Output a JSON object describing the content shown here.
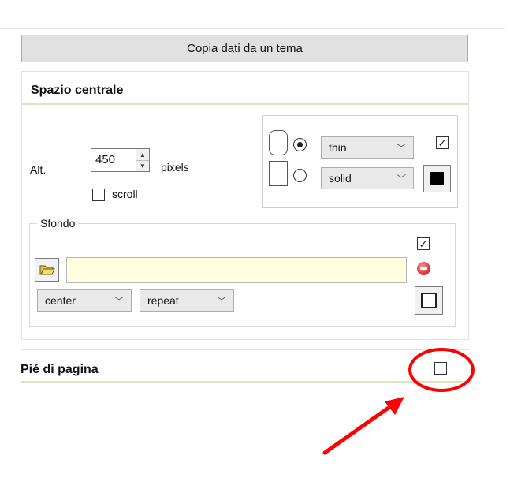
{
  "toolbar": {
    "copy_button": "Copia dati da un tema"
  },
  "center_section": {
    "title": "Spazio centrale",
    "height_label": "Alt.",
    "height_value": "450",
    "unit_label": "pixels",
    "scroll_label": "scroll",
    "scroll_checked": false,
    "border": {
      "width_selected": "thin",
      "style_selected": "solid",
      "enabled_checked": true,
      "color": "#000000",
      "corner_options": [
        "rounded",
        "square"
      ],
      "corner_selected": "rounded"
    },
    "background": {
      "legend": "Sfondo",
      "enabled_checked": true,
      "path_value": "",
      "position_selected": "center",
      "repeat_selected": "repeat",
      "color": "#ffffff"
    }
  },
  "footer_section": {
    "title": "Pié di pagina",
    "enabled_checked": false
  },
  "colors": {
    "accent_line": "#d9e6bf",
    "path_field_bg": "#ffffe0",
    "annotation": "#ff0000"
  }
}
